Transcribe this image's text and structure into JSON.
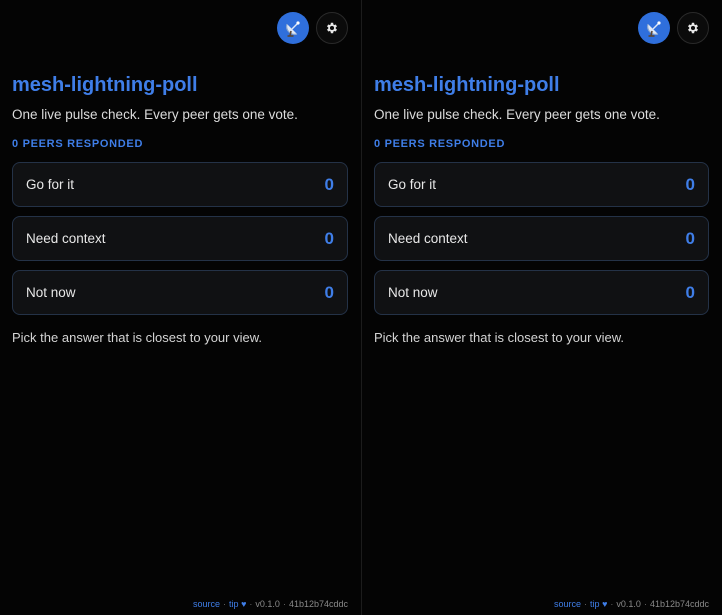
{
  "panes": [
    {
      "title": "mesh-lightning-poll",
      "subtitle": "One live pulse check. Every peer gets one vote.",
      "responded": "0 PEERS RESPONDED",
      "options": [
        {
          "label": "Go for it",
          "count": "0"
        },
        {
          "label": "Need context",
          "count": "0"
        },
        {
          "label": "Not now",
          "count": "0"
        }
      ],
      "hint": "Pick the answer that is closest to your view.",
      "footer": {
        "source": "source",
        "tip": "tip",
        "heart": "♥",
        "version": "v0.1.0",
        "hash": "41b12b74cddc",
        "sep": "·"
      }
    },
    {
      "title": "mesh-lightning-poll",
      "subtitle": "One live pulse check. Every peer gets one vote.",
      "responded": "0 PEERS RESPONDED",
      "options": [
        {
          "label": "Go for it",
          "count": "0"
        },
        {
          "label": "Need context",
          "count": "0"
        },
        {
          "label": "Not now",
          "count": "0"
        }
      ],
      "hint": "Pick the answer that is closest to your view.",
      "footer": {
        "source": "source",
        "tip": "tip",
        "heart": "♥",
        "version": "v0.1.0",
        "hash": "41b12b74cddc",
        "sep": "·"
      }
    }
  ],
  "icons": {
    "peer": "satellite-dish-icon",
    "settings": "gear-icon"
  },
  "colors": {
    "accent": "#3f7ee8",
    "peer_button": "#2f6fdc",
    "background": "#040404",
    "card": "#101113",
    "card_border": "#243247"
  }
}
